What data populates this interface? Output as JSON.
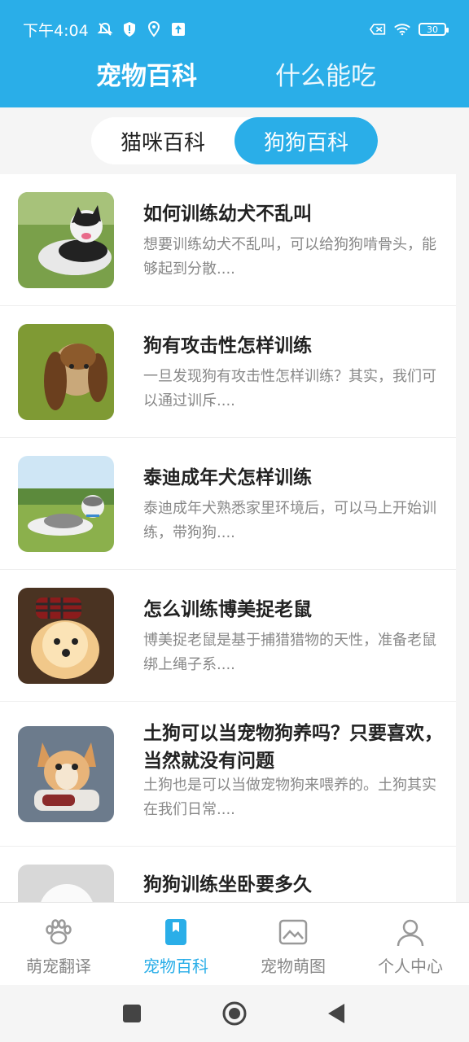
{
  "status": {
    "time": "下午4:04",
    "battery": "30"
  },
  "header": {
    "tabs": [
      {
        "label": "宠物百科"
      },
      {
        "label": "什么能吃"
      }
    ]
  },
  "segment": {
    "options": [
      {
        "label": "猫咪百科",
        "selected": false
      },
      {
        "label": "狗狗百科",
        "selected": true
      }
    ]
  },
  "articles": [
    {
      "title": "如何训练幼犬不乱叫",
      "desc": "想要训练幼犬不乱叫，可以给狗狗啃骨头，能够起到分散...."
    },
    {
      "title": "狗有攻击性怎样训练",
      "desc": "一旦发现狗有攻击性怎样训练？其实，我们可以通过训斥...."
    },
    {
      "title": "泰迪成年犬怎样训练",
      "desc": "泰迪成年犬熟悉家里环境后，可以马上开始训练，带狗狗...."
    },
    {
      "title": "怎么训练博美捉老鼠",
      "desc": "博美捉老鼠是基于捕猎猎物的天性，准备老鼠绑上绳子系...."
    },
    {
      "title": "土狗可以当宠物狗养吗？只要喜欢，当然就没有问题",
      "desc": "土狗也是可以当做宠物狗来喂养的。土狗其实在我们日常...."
    },
    {
      "title": "狗狗训练坐卧要多久",
      "desc": ""
    }
  ],
  "bottom_nav": {
    "items": [
      {
        "label": "萌宠翻译",
        "icon": "paw-icon"
      },
      {
        "label": "宠物百科",
        "icon": "bookmark-book-icon"
      },
      {
        "label": "宠物萌图",
        "icon": "picture-icon"
      },
      {
        "label": "个人中心",
        "icon": "person-icon"
      }
    ],
    "active_index": 1
  },
  "colors": {
    "accent": "#2aaee8"
  }
}
